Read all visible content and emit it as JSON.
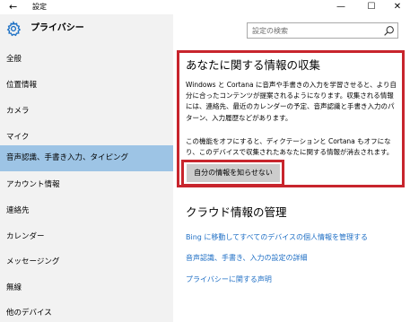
{
  "window": {
    "title": "設定",
    "back_glyph": "←",
    "minimize_glyph": "—",
    "maximize_glyph": "☐",
    "close_glyph": "✕"
  },
  "header": {
    "title": "プライバシー",
    "icon": "gear-icon"
  },
  "search": {
    "placeholder": "設定の検索",
    "icon": "search-icon"
  },
  "sidebar": {
    "items": [
      {
        "label": "全般"
      },
      {
        "label": "位置情報"
      },
      {
        "label": "カメラ"
      },
      {
        "label": "マイク"
      },
      {
        "label": "音声認識、手書き入力、タイピング",
        "selected": true
      },
      {
        "label": "アカウント情報"
      },
      {
        "label": "連絡先"
      },
      {
        "label": "カレンダー"
      },
      {
        "label": "メッセージング"
      },
      {
        "label": "無線"
      },
      {
        "label": "他のデバイス"
      }
    ],
    "selected_color": "#9dc4e5"
  },
  "main": {
    "section1": {
      "title": "あなたに関する情報の収集",
      "paragraph1": "Windows と Cortana に音声や手書きの入力を学習させると、より自分に合ったコンテンツが提案されるようになります。収集される情報には、連絡先、最近のカレンダーの予定、音声認識と手書き入力のパターン、入力履歴などがあります。",
      "paragraph2": "この機能をオフにすると、ディクテーションと Cortana もオフになり、このデバイスで収集されたあなたに関する情報が消去されます。",
      "button_label": "自分の情報を知らせない"
    },
    "section2": {
      "title": "クラウド情報の管理",
      "links": [
        {
          "label": "Bing に移動してすべてのデバイスの個人情報を管理する"
        },
        {
          "label": "音声認識、手書き、入力の設定の詳細"
        },
        {
          "label": "プライバシーに関する声明"
        }
      ]
    }
  },
  "colors": {
    "highlight_border": "#c8252d",
    "link": "#1f6fc5",
    "sidebar_bg": "#f2f2f2",
    "button_bg": "#cccccc"
  }
}
